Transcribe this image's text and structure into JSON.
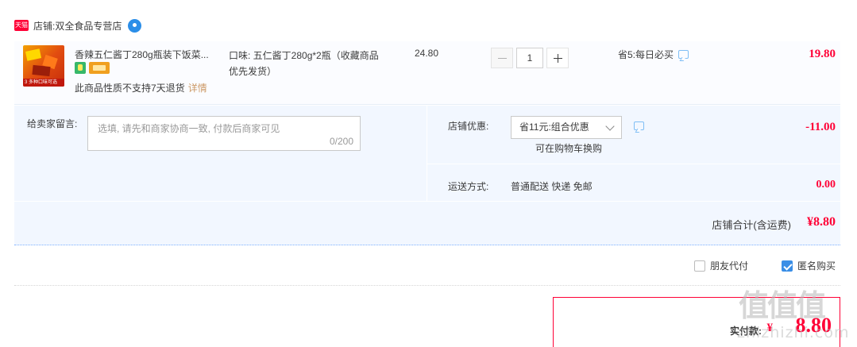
{
  "shop": {
    "badge": "天猫",
    "prefix": "店铺: ",
    "name": "双全食品专营店",
    "icon": "wangwang-chat-icon"
  },
  "item": {
    "title": "香辣五仁酱丁280g瓶装下饭菜...",
    "sku": "口味: 五仁酱丁280g*2瓶（收藏商品优先发货）",
    "unit_price": "24.80",
    "quantity": "1",
    "promo": "省5:每日必买",
    "total": "19.80",
    "return_note": "此商品性质不支持7天退货",
    "details_link": "详情",
    "thumb_tag": "3 多种口味可选"
  },
  "message": {
    "label": "给卖家留言:",
    "placeholder": "选填, 请先和商家协商一致, 付款后商家可见",
    "counter": "0/200"
  },
  "discount": {
    "label": "店铺优惠:",
    "selected": "省11元:组合优惠",
    "note": "可在购物车换购",
    "amount": "-11.00"
  },
  "shipping": {
    "label": "运送方式:",
    "value": "普通配送 快递 免邮",
    "amount": "0.00"
  },
  "shop_total": {
    "label": "店铺合计(含运费)",
    "amount": "¥8.80"
  },
  "options": {
    "friend_pay": "朋友代付",
    "friend_pay_checked": false,
    "anonymous": "匿名购买",
    "anonymous_checked": true
  },
  "payment": {
    "label": "实付款:",
    "currency": "¥",
    "amount": "8.80"
  },
  "watermark": {
    "logo": "值值值",
    "text": "zhizhizhi.com"
  },
  "colors": {
    "price_red": "#ff0036",
    "panel_blue": "#f2f7ff",
    "checkbox_blue": "#3a8ee6",
    "link_tan": "#cc9966"
  }
}
